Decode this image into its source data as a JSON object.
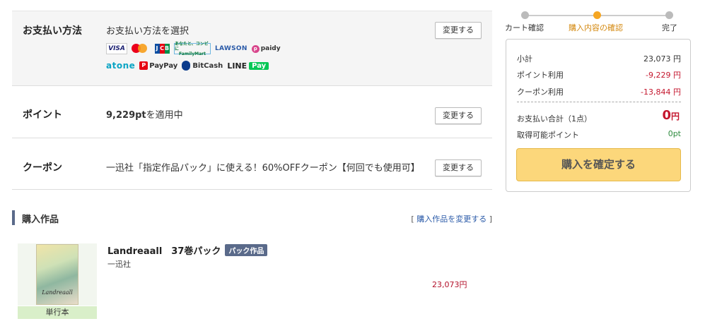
{
  "payment": {
    "label": "お支払い方法",
    "value": "お支払い方法を選択",
    "change_label": "変更する",
    "logos_row1": [
      "VISA",
      "Mastercard",
      "JCB",
      "FamilyMart",
      "LAWSON",
      "paidy"
    ],
    "logos_row2": [
      "atone",
      "PayPay",
      "BitCash",
      "LINE Pay"
    ]
  },
  "logo_text": {
    "visa": "VISA",
    "familymart_1": "あなたと、コンビに",
    "familymart_2": "FamilyMart",
    "lawson": "LAWSON",
    "paidy": "paidy",
    "atone": "atone",
    "paypay": "PayPay",
    "bitcash": "BitCash",
    "line": "LINE",
    "pay": "Pay"
  },
  "points": {
    "label": "ポイント",
    "value_bold": "9,229pt",
    "value_rest": "を適用中",
    "change_label": "変更する"
  },
  "coupon": {
    "label": "クーポン",
    "value": "一迅社「指定作品パック」に使える！60%OFFクーポン【何回でも使用可】",
    "change_label": "変更する"
  },
  "purchase_section": {
    "title": "購入作品",
    "bracket_open": "[",
    "change_link": "購入作品を変更する",
    "bracket_close": "]"
  },
  "item": {
    "title": "Landreaall　37巻パック",
    "badge": "パック作品",
    "publisher": "一迅社",
    "format": "単行本",
    "price": "23,073円",
    "cover_title": "Landreaall"
  },
  "steps": [
    {
      "label": "カート確認",
      "active": false
    },
    {
      "label": "購入内容の確認",
      "active": true
    },
    {
      "label": "完了",
      "active": false
    }
  ],
  "summary": {
    "subtotal_label": "小計",
    "subtotal_value": "23,073 円",
    "points_label": "ポイント利用",
    "points_value": "-9,229 円",
    "coupon_label": "クーポン利用",
    "coupon_value": "-13,844 円",
    "total_label": "お支払い合計（1点）",
    "total_number": "0",
    "total_unit": "円",
    "earn_label": "取得可能ポイント",
    "earn_value": "0pt",
    "buy_button": "購入を確定する"
  },
  "colors": {
    "accent_orange": "#f5a623",
    "price_red": "#c4162d",
    "buy_button_bg": "#fcd77b",
    "points_green": "#2e8b3e",
    "section_bar": "#5a6a8a"
  }
}
